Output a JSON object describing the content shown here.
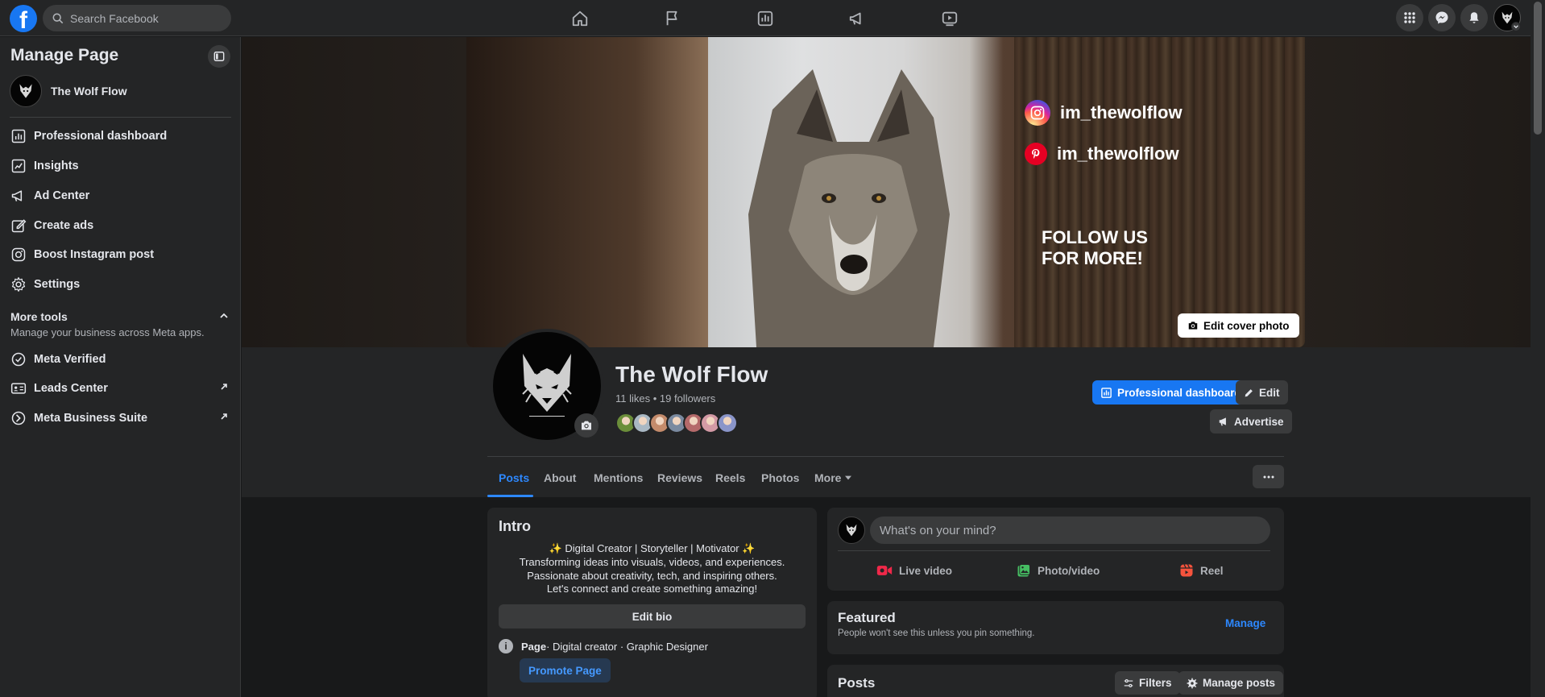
{
  "topbar": {
    "logo_letter": "f",
    "search_placeholder": "Search Facebook"
  },
  "sidebar": {
    "title": "Manage Page",
    "page_name": "The Wolf Flow",
    "items": [
      {
        "label": "Professional dashboard",
        "icon": "dashboard-icon"
      },
      {
        "label": "Insights",
        "icon": "insights-icon"
      },
      {
        "label": "Ad Center",
        "icon": "megaphone-icon"
      },
      {
        "label": "Create ads",
        "icon": "pencil-icon"
      },
      {
        "label": "Boost Instagram post",
        "icon": "instagram-icon"
      },
      {
        "label": "Settings",
        "icon": "gear-icon"
      }
    ],
    "more_tools": {
      "title": "More tools",
      "subtitle": "Manage your business across Meta apps.",
      "items": [
        {
          "label": "Meta Verified",
          "icon": "verified-badge-icon"
        },
        {
          "label": "Leads Center",
          "icon": "id-card-icon"
        },
        {
          "label": "Meta Business Suite",
          "icon": "business-suite-icon"
        }
      ]
    }
  },
  "cover": {
    "instagram_handle": "im_thewolflow",
    "pinterest_handle": "im_thewolflow",
    "follow_line1": "FOLLOW US",
    "follow_line2": "FOR MORE!",
    "edit_cover_label": "Edit cover photo"
  },
  "profile": {
    "name": "The Wolf Flow",
    "stats": "11 likes • 19 followers",
    "follower_face_colors": [
      "#6b8e3a",
      "#a9b8c4",
      "#c48b6b",
      "#7a8aa0",
      "#b56a6a",
      "#d39aa5",
      "#8a95c9"
    ],
    "pro_dashboard_label": "Professional dashboard",
    "edit_label": "Edit",
    "advertise_label": "Advertise"
  },
  "tabs": [
    "Posts",
    "About",
    "Mentions",
    "Reviews",
    "Reels",
    "Photos",
    "More"
  ],
  "intro": {
    "title": "Intro",
    "bio_lines": [
      "✨ Digital Creator | Storyteller | Motivator ✨",
      "Transforming ideas into visuals, videos, and experiences.",
      "Passionate about creativity, tech, and inspiring others.",
      "Let's connect and create something amazing!"
    ],
    "edit_bio_label": "Edit bio",
    "page_label": "Page",
    "page_category": " · Digital creator · Graphic Designer",
    "promote_label": "Promote Page"
  },
  "composer": {
    "placeholder": "What's on your mind?",
    "live_label": "Live video",
    "photo_label": "Photo/video",
    "reel_label": "Reel"
  },
  "featured": {
    "title": "Featured",
    "subtitle": "People won't see this unless you pin something.",
    "manage_label": "Manage"
  },
  "posts": {
    "title": "Posts",
    "filters_label": "Filters",
    "manage_posts_label": "Manage posts"
  },
  "colors": {
    "brand_blue": "#1877f2",
    "link_blue": "#2d88ff",
    "surface": "#242526",
    "background": "#18191a"
  }
}
